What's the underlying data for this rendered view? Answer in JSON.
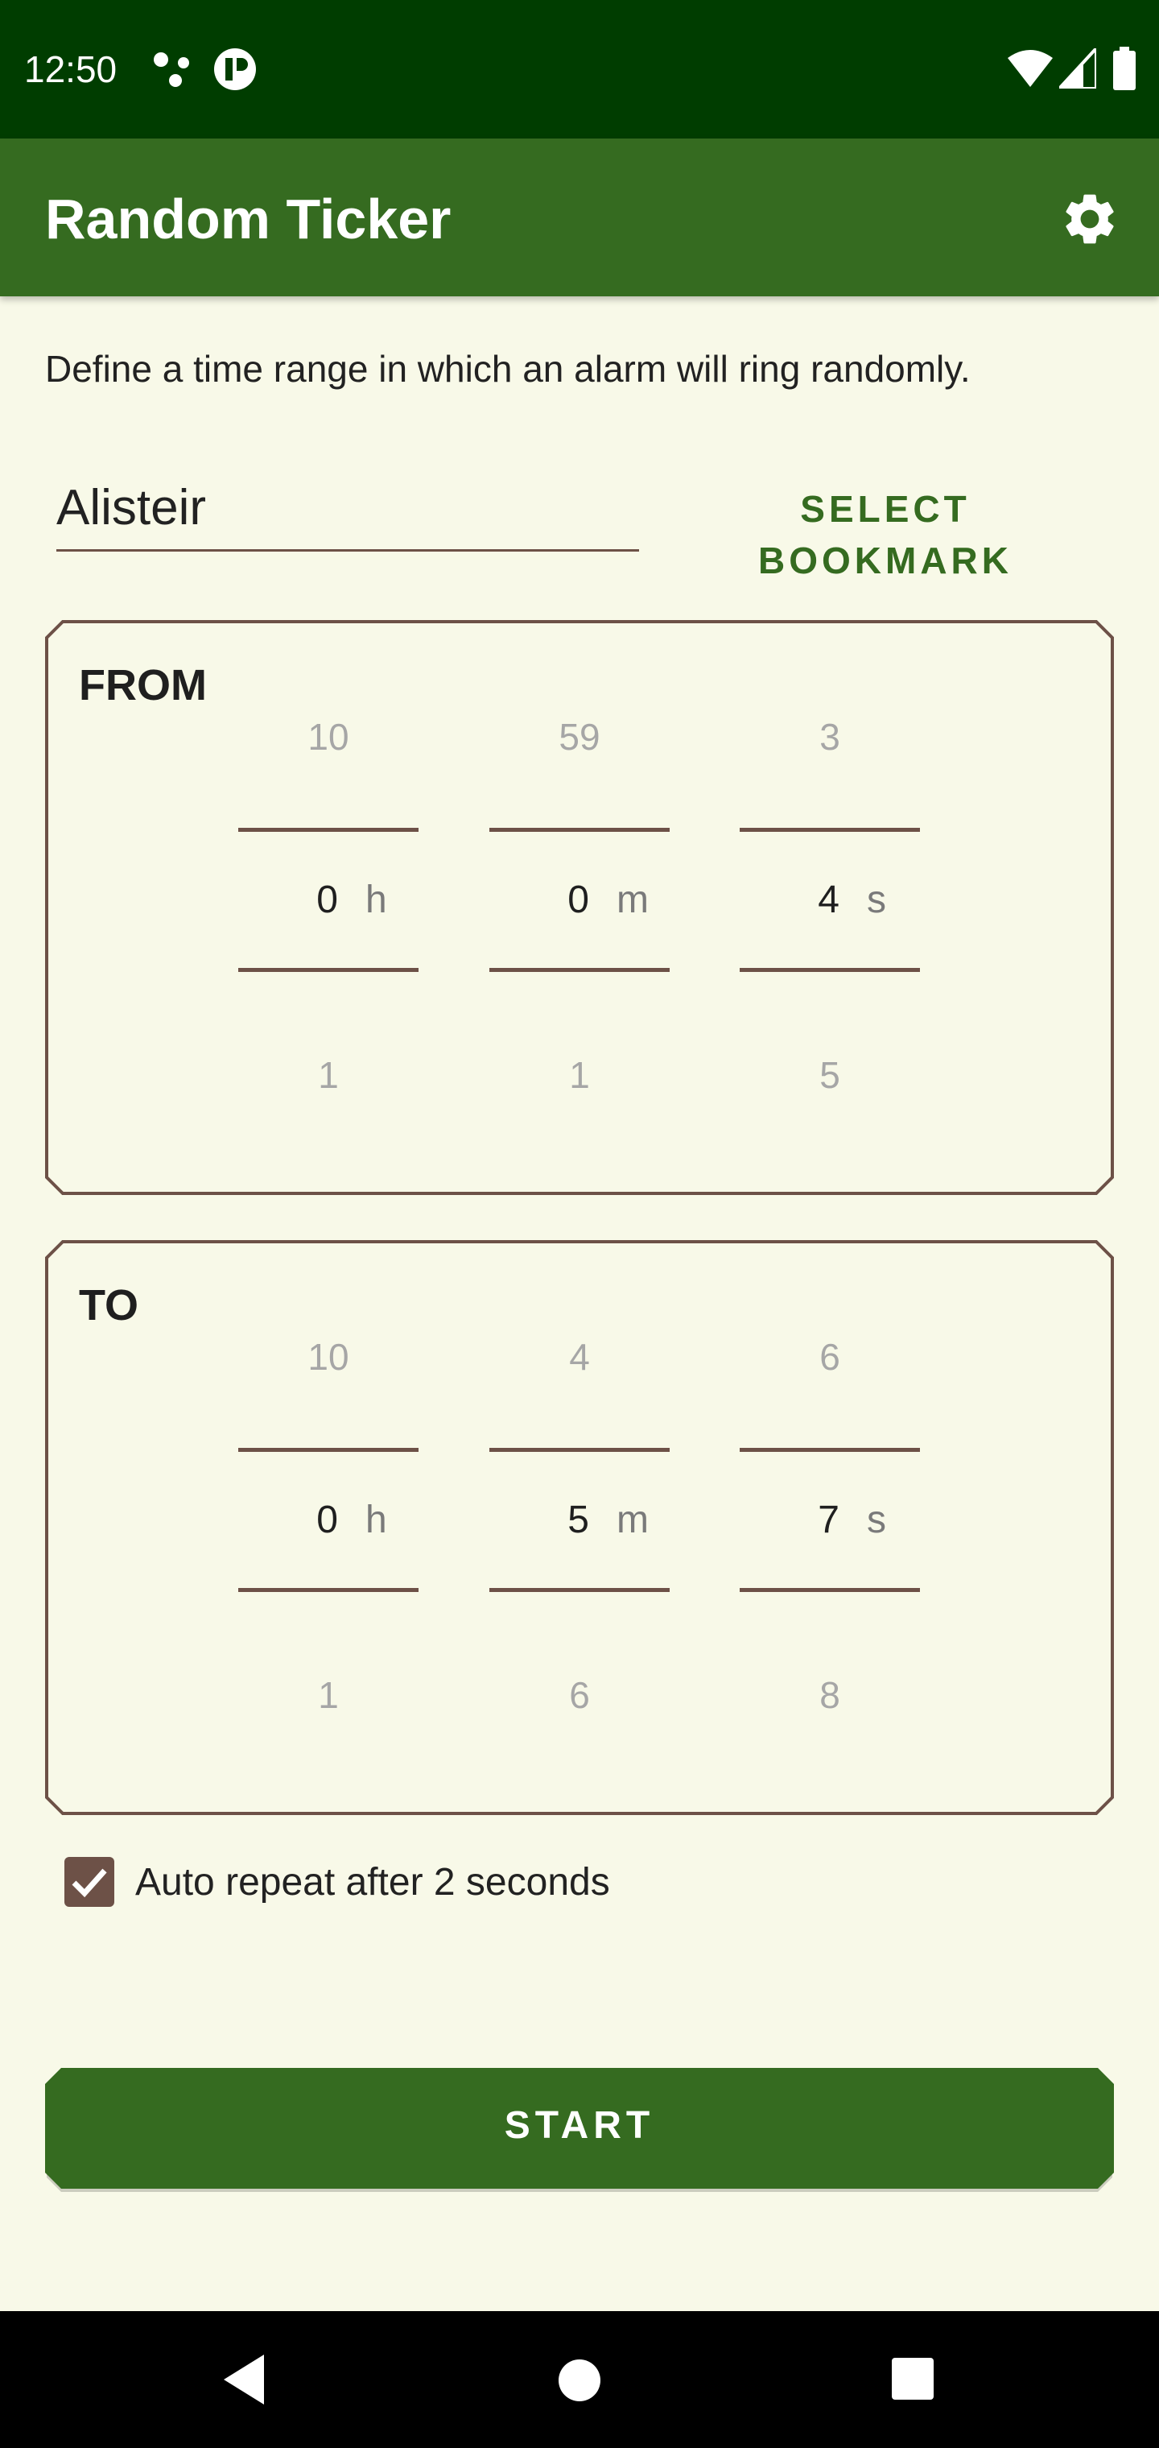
{
  "status_bar": {
    "time": "12:50",
    "icons": [
      "notification-dots-icon",
      "app-notification-icon",
      "wifi-icon",
      "cell-signal-icon",
      "battery-icon"
    ]
  },
  "app_bar": {
    "title": "Random Ticker",
    "settings_icon": "gear-icon",
    "background": "#356b20"
  },
  "description": "Define a time range in which an alarm will ring randomly.",
  "bookmark": {
    "name_value": "Alisteir",
    "select_label": "SELECT BOOKMARK"
  },
  "from": {
    "title": "FROM",
    "hours": {
      "prev": "10",
      "current": "0",
      "next": "1",
      "unit": "h"
    },
    "minutes": {
      "prev": "59",
      "current": "0",
      "next": "1",
      "unit": "m"
    },
    "seconds": {
      "prev": "3",
      "current": "4",
      "next": "5",
      "unit": "s"
    }
  },
  "to": {
    "title": "TO",
    "hours": {
      "prev": "10",
      "current": "0",
      "next": "1",
      "unit": "h"
    },
    "minutes": {
      "prev": "4",
      "current": "5",
      "next": "6",
      "unit": "m"
    },
    "seconds": {
      "prev": "6",
      "current": "7",
      "next": "8",
      "unit": "s"
    }
  },
  "auto_repeat": {
    "checked": true,
    "label": "Auto repeat after 2 seconds"
  },
  "start_button": {
    "label": "START"
  },
  "nav_bar": {
    "icons": [
      "back-icon",
      "home-icon",
      "recent-apps-icon"
    ]
  },
  "colors": {
    "status_bar": "#003d00",
    "primary": "#356b20",
    "background": "#f8f9e8",
    "outline": "#6d5147"
  }
}
